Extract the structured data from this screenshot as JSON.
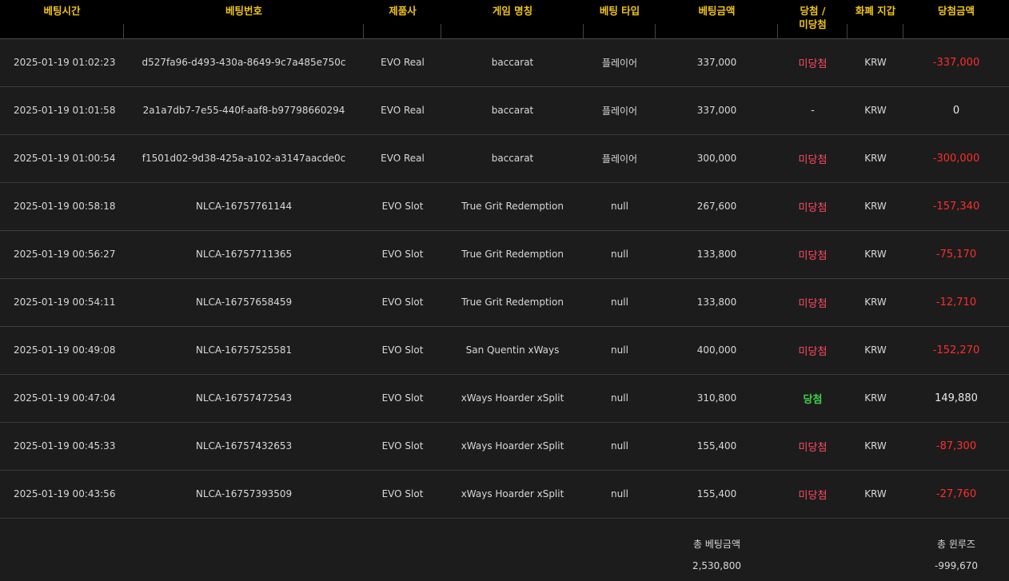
{
  "headers": {
    "time": "베팅시간",
    "id": "베팅번호",
    "provider": "제품사",
    "game": "게임 명칭",
    "type": "베팅 타입",
    "amount": "베팅금액",
    "result_line1": "당첨 /",
    "result_line2": "미당첨",
    "currency": "화폐 지갑",
    "win": "당첨금액"
  },
  "rows": [
    {
      "time": "2025-01-19 01:02:23",
      "id": "d527fa96-d493-430a-8649-9c7a485e750c",
      "provider": "EVO Real",
      "game": "baccarat",
      "type": "플레이어",
      "amount": "337,000",
      "result": "미당첨",
      "currency": "KRW",
      "win": "-337,000"
    },
    {
      "time": "2025-01-19 01:01:58",
      "id": "2a1a7db7-7e55-440f-aaf8-b97798660294",
      "provider": "EVO Real",
      "game": "baccarat",
      "type": "플레이어",
      "amount": "337,000",
      "result": "-",
      "currency": "KRW",
      "win": "0"
    },
    {
      "time": "2025-01-19 01:00:54",
      "id": "f1501d02-9d38-425a-a102-a3147aacde0c",
      "provider": "EVO Real",
      "game": "baccarat",
      "type": "플레이어",
      "amount": "300,000",
      "result": "미당첨",
      "currency": "KRW",
      "win": "-300,000"
    },
    {
      "time": "2025-01-19 00:58:18",
      "id": "NLCA-16757761144",
      "provider": "EVO Slot",
      "game": "True Grit Redemption",
      "type": "null",
      "amount": "267,600",
      "result": "미당첨",
      "currency": "KRW",
      "win": "-157,340"
    },
    {
      "time": "2025-01-19 00:56:27",
      "id": "NLCA-16757711365",
      "provider": "EVO Slot",
      "game": "True Grit Redemption",
      "type": "null",
      "amount": "133,800",
      "result": "미당첨",
      "currency": "KRW",
      "win": "-75,170"
    },
    {
      "time": "2025-01-19 00:54:11",
      "id": "NLCA-16757658459",
      "provider": "EVO Slot",
      "game": "True Grit Redemption",
      "type": "null",
      "amount": "133,800",
      "result": "미당첨",
      "currency": "KRW",
      "win": "-12,710"
    },
    {
      "time": "2025-01-19 00:49:08",
      "id": "NLCA-16757525581",
      "provider": "EVO Slot",
      "game": "San Quentin xWays",
      "type": "null",
      "amount": "400,000",
      "result": "미당첨",
      "currency": "KRW",
      "win": "-152,270"
    },
    {
      "time": "2025-01-19 00:47:04",
      "id": "NLCA-16757472543",
      "provider": "EVO Slot",
      "game": "xWays Hoarder xSplit",
      "type": "null",
      "amount": "310,800",
      "result": "당첨",
      "currency": "KRW",
      "win": "149,880"
    },
    {
      "time": "2025-01-19 00:45:33",
      "id": "NLCA-16757432653",
      "provider": "EVO Slot",
      "game": "xWays Hoarder xSplit",
      "type": "null",
      "amount": "155,400",
      "result": "미당첨",
      "currency": "KRW",
      "win": "-87,300"
    },
    {
      "time": "2025-01-19 00:43:56",
      "id": "NLCA-16757393509",
      "provider": "EVO Slot",
      "game": "xWays Hoarder xSplit",
      "type": "null",
      "amount": "155,400",
      "result": "미당첨",
      "currency": "KRW",
      "win": "-27,760"
    }
  ],
  "summary": {
    "total_bet_label": "총 베팅금액",
    "total_bet_value": "2,530,800",
    "total_winloss_label": "총 윈루즈",
    "total_winloss_value": "-999,670"
  },
  "colors": {
    "header_text": "#f0c419",
    "lose": "#ff4b5c",
    "win": "#3fd24b",
    "negative_amount": "#ff2d2d"
  }
}
